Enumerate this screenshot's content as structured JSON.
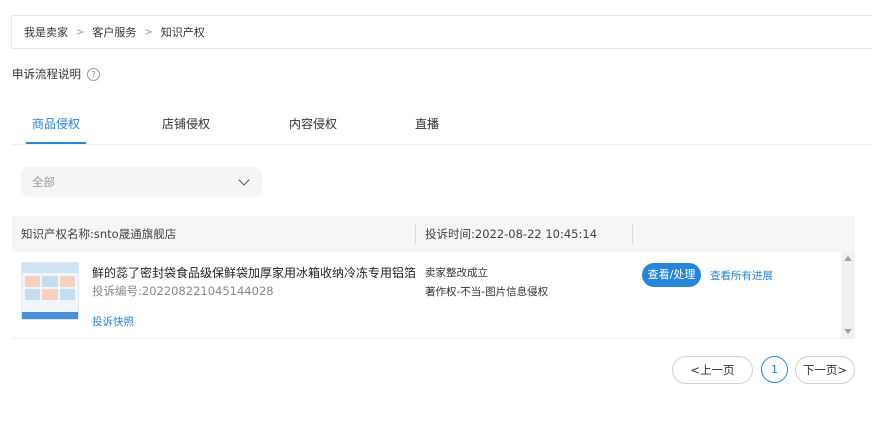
{
  "breadcrumb": [
    "我是卖家",
    "客户服务",
    "知识产权"
  ],
  "breadcrumb_separator": ">",
  "help": {
    "label": "申诉流程说明",
    "icon": "question-circle-icon"
  },
  "tabs": [
    {
      "label": "商品侵权",
      "active": true
    },
    {
      "label": "店铺侵权",
      "active": false
    },
    {
      "label": "内容侵权",
      "active": false
    },
    {
      "label": "直播",
      "active": false
    }
  ],
  "filter": {
    "selected": "全部",
    "icon": "chevron-down-icon"
  },
  "table": {
    "ip_name": "知识产权名称:snto晟通旗舰店",
    "complaint_time": "投诉时间:2022-08-22 10:45:14"
  },
  "row": {
    "product_title": "鲜的蕊了密封袋食品级保鲜袋加厚家用冰箱收纳冷冻专用铝箔",
    "complaint_no": "投诉编号:202208221045144028",
    "snapshot_link": "投诉快照",
    "status": "卖家整改成立",
    "reason": "著作权-不当-图片信息侵权",
    "primary_action": "查看/处理",
    "secondary_action": "查看所有进展"
  },
  "pagination": {
    "prev": "<上一页",
    "current": "1",
    "next": "下一页>"
  },
  "colors": {
    "accent": "#2684d9",
    "header_bg": "#f5f6f7",
    "filter_bg": "#f5f5f5"
  }
}
